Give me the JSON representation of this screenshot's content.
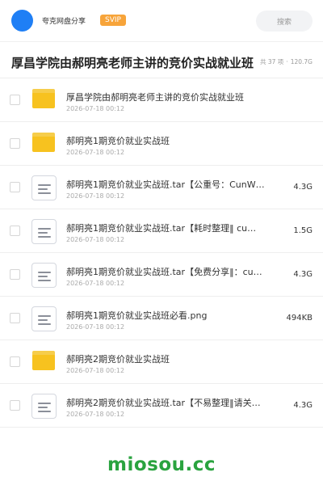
{
  "header": {
    "share_name": "夸克网盘分享",
    "badge": "SVIP",
    "search_label": "搜索"
  },
  "page": {
    "title": "厚昌学院由郝明亮老师主讲的竞价实战就业班",
    "item_count": "共 37 项",
    "separator": "·",
    "total_size": "120.7G"
  },
  "files": [
    {
      "type": "folder",
      "name": "厚昌学院由郝明亮老师主讲的竞价实战就业班",
      "date": "2026-07-18 00:12",
      "size": ""
    },
    {
      "type": "folder",
      "name": "郝明亮1期竞价就业实战班",
      "date": "2026-07-18 00:12",
      "size": ""
    },
    {
      "type": "file",
      "name": "郝明亮1期竞价就业实战班.tar【公重号：CunW…",
      "date": "2026-07-18 00:12",
      "size": "4.3G"
    },
    {
      "type": "file",
      "name": "郝明亮1期竞价就业实战班.tar【耗时整理‖ cu…",
      "date": "2026-07-18 00:12",
      "size": "1.5G"
    },
    {
      "type": "file",
      "name": "郝明亮1期竞价就业实战班.tar【免费分享‖：cu…",
      "date": "2026-07-18 00:12",
      "size": "4.3G"
    },
    {
      "type": "file",
      "name": "郝明亮1期竞价就业实战班必看.png",
      "date": "2026-07-18 00:12",
      "size": "494KB"
    },
    {
      "type": "folder",
      "name": "郝明亮2期竞价就业实战班",
      "date": "2026-07-18 00:12",
      "size": ""
    },
    {
      "type": "file",
      "name": "郝明亮2期竞价就业实战班.tar【不易整理‖请关注…",
      "date": "2026-07-18 00:12",
      "size": "4.3G"
    }
  ],
  "watermark": "miosou.cc",
  "colors": {
    "accent": "#1f7ff5",
    "badge": "#f7a43a",
    "folder": "#f7c21f",
    "watermark": "#2aa33f"
  }
}
